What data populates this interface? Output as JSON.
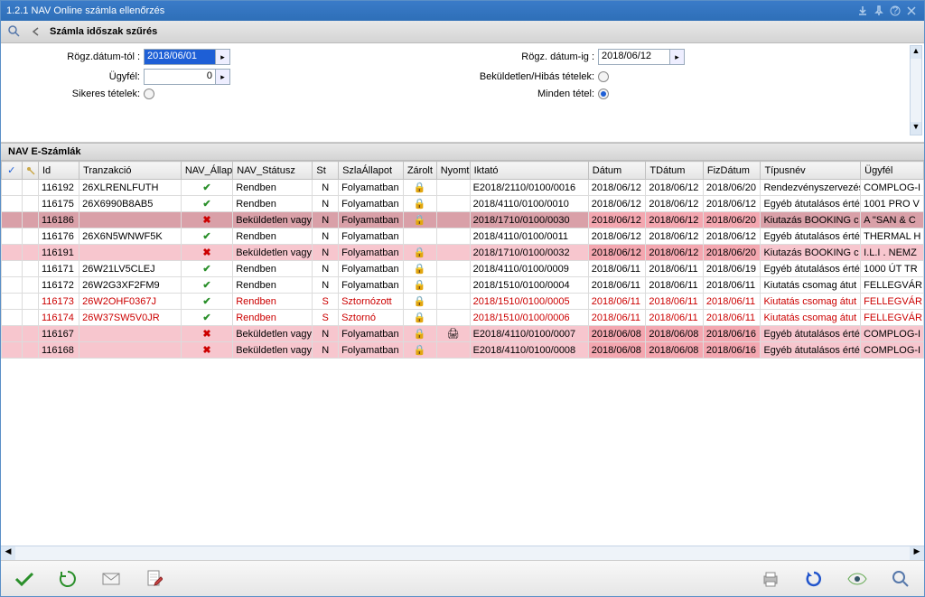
{
  "window": {
    "title": "1.2.1 NAV Online számla ellenőrzés"
  },
  "filter": {
    "header": "Számla időszak szűrés",
    "date_from_label": "Rögz.dátum-tól :",
    "date_from_value": "2018/06/01",
    "date_to_label": "Rögz. dátum-ig :",
    "date_to_value": "2018/06/12",
    "ugyfel_label": "Ügyfél:",
    "ugyfel_value": "0",
    "bekuldetlen_label": "Beküldetlen/Hibás tételek:",
    "sikeres_label": "Sikeres tételek:",
    "minden_label": "Minden tétel:"
  },
  "grid_header": "NAV E-Számlák",
  "columns": {
    "check": "✓",
    "key": "",
    "id": "Id",
    "tranzakcio": "Tranzakció",
    "nav_allap": "NAV_Állap",
    "nav_statusz": "NAV_Státusz",
    "st": "St",
    "szlaallapot": "SzlaÁllapot",
    "zarolt": "Zárolt",
    "nyom": "Nyomt",
    "iktato": "Iktató",
    "datum": "Dátum",
    "tdatum": "TDátum",
    "fizdatum": "FizDátum",
    "tipusnev": "Típusnév",
    "ugyfel": "Ügyfél"
  },
  "rows": [
    {
      "id": "116192",
      "tranzakcio": "26XLRENLFUTH",
      "nav_allap": "ok",
      "nav_statusz": "Rendben",
      "st": "N",
      "szlaallapot": "Folyamatban",
      "zarolt": "lock",
      "nyom": "",
      "iktato": "E2018/2110/0100/0016",
      "datum": "2018/06/12",
      "tdatum": "2018/06/12",
      "fizdatum": "2018/06/20",
      "tipusnev": "Rendezvényszervezés",
      "ugyfel": "COMPLOG-I",
      "style": "",
      "red": false
    },
    {
      "id": "116175",
      "tranzakcio": "26X6990B8AB5",
      "nav_allap": "ok",
      "nav_statusz": "Rendben",
      "st": "N",
      "szlaallapot": "Folyamatban",
      "zarolt": "lock",
      "nyom": "",
      "iktato": "2018/4110/0100/0010",
      "datum": "2018/06/12",
      "tdatum": "2018/06/12",
      "fizdatum": "2018/06/12",
      "tipusnev": "Egyéb átutalásos érté",
      "ugyfel": "1001 PRO V",
      "style": "",
      "red": false
    },
    {
      "id": "116186",
      "tranzakcio": "",
      "nav_allap": "err",
      "nav_statusz": "Beküldetlen vagy",
      "st": "N",
      "szlaallapot": "Folyamatban",
      "zarolt": "lock2",
      "nyom": "",
      "iktato": "2018/1710/0100/0030",
      "datum": "2018/06/12",
      "tdatum": "2018/06/12",
      "fizdatum": "2018/06/20",
      "tipusnev": "Kiutazás BOOKING c",
      "ugyfel": "A \"SAN & C",
      "style": "sel",
      "red": false
    },
    {
      "id": "116176",
      "tranzakcio": "26X6N5WNWF5K",
      "nav_allap": "ok",
      "nav_statusz": "Rendben",
      "st": "N",
      "szlaallapot": "Folyamatban",
      "zarolt": "",
      "nyom": "",
      "iktato": "2018/4110/0100/0011",
      "datum": "2018/06/12",
      "tdatum": "2018/06/12",
      "fizdatum": "2018/06/12",
      "tipusnev": "Egyéb átutalásos érté",
      "ugyfel": "THERMAL H",
      "style": "",
      "red": false
    },
    {
      "id": "116191",
      "tranzakcio": "",
      "nav_allap": "err",
      "nav_statusz": "Beküldetlen vagy",
      "st": "N",
      "szlaallapot": "Folyamatban",
      "zarolt": "lock",
      "nyom": "",
      "iktato": "2018/1710/0100/0032",
      "datum": "2018/06/12",
      "tdatum": "2018/06/12",
      "fizdatum": "2018/06/20",
      "tipusnev": "Kiutazás BOOKING c",
      "ugyfel": "I.L.I . NEMZ",
      "style": "pink",
      "red": false
    },
    {
      "id": "116171",
      "tranzakcio": "26W21LV5CLEJ",
      "nav_allap": "ok",
      "nav_statusz": "Rendben",
      "st": "N",
      "szlaallapot": "Folyamatban",
      "zarolt": "lock",
      "nyom": "",
      "iktato": "2018/4110/0100/0009",
      "datum": "2018/06/11",
      "tdatum": "2018/06/11",
      "fizdatum": "2018/06/19",
      "tipusnev": "Egyéb átutalásos érté",
      "ugyfel": "1000 ÚT TR",
      "style": "",
      "red": false
    },
    {
      "id": "116172",
      "tranzakcio": "26W2G3XF2FM9",
      "nav_allap": "ok",
      "nav_statusz": "Rendben",
      "st": "N",
      "szlaallapot": "Folyamatban",
      "zarolt": "lock",
      "nyom": "",
      "iktato": "2018/1510/0100/0004",
      "datum": "2018/06/11",
      "tdatum": "2018/06/11",
      "fizdatum": "2018/06/11",
      "tipusnev": "Kiutatás  csomag átut",
      "ugyfel": "FELLEGVÁR",
      "style": "",
      "red": false
    },
    {
      "id": "116173",
      "tranzakcio": "26W2OHF0367J",
      "nav_allap": "ok",
      "nav_statusz": "Rendben",
      "st": "S",
      "szlaallapot": "Sztornózott",
      "zarolt": "lock",
      "nyom": "",
      "iktato": "2018/1510/0100/0005",
      "datum": "2018/06/11",
      "tdatum": "2018/06/11",
      "fizdatum": "2018/06/11",
      "tipusnev": "Kiutatás  csomag átut",
      "ugyfel": "FELLEGVÁR",
      "style": "",
      "red": true
    },
    {
      "id": "116174",
      "tranzakcio": "26W37SW5V0JR",
      "nav_allap": "ok",
      "nav_statusz": "Rendben",
      "st": "S",
      "szlaallapot": "Sztornó",
      "zarolt": "lock",
      "nyom": "",
      "iktato": "2018/1510/0100/0006",
      "datum": "2018/06/11",
      "tdatum": "2018/06/11",
      "fizdatum": "2018/06/11",
      "tipusnev": "Kiutatás  csomag átut",
      "ugyfel": "FELLEGVÁR",
      "style": "",
      "red": true
    },
    {
      "id": "116167",
      "tranzakcio": "",
      "nav_allap": "err",
      "nav_statusz": "Beküldetlen vagy",
      "st": "N",
      "szlaallapot": "Folyamatban",
      "zarolt": "lock",
      "nyom": "print",
      "iktato": "E2018/4110/0100/0007",
      "datum": "2018/06/08",
      "tdatum": "2018/06/08",
      "fizdatum": "2018/06/16",
      "tipusnev": "Egyéb átutalásos érté",
      "ugyfel": "COMPLOG-I",
      "style": "pink",
      "red": false
    },
    {
      "id": "116168",
      "tranzakcio": "",
      "nav_allap": "err",
      "nav_statusz": "Beküldetlen vagy",
      "st": "N",
      "szlaallapot": "Folyamatban",
      "zarolt": "lock",
      "nyom": "",
      "iktato": "E2018/4110/0100/0008",
      "datum": "2018/06/08",
      "tdatum": "2018/06/08",
      "fizdatum": "2018/06/16",
      "tipusnev": "Egyéb átutalásos érté",
      "ugyfel": "COMPLOG-I",
      "style": "pink",
      "red": false
    }
  ]
}
